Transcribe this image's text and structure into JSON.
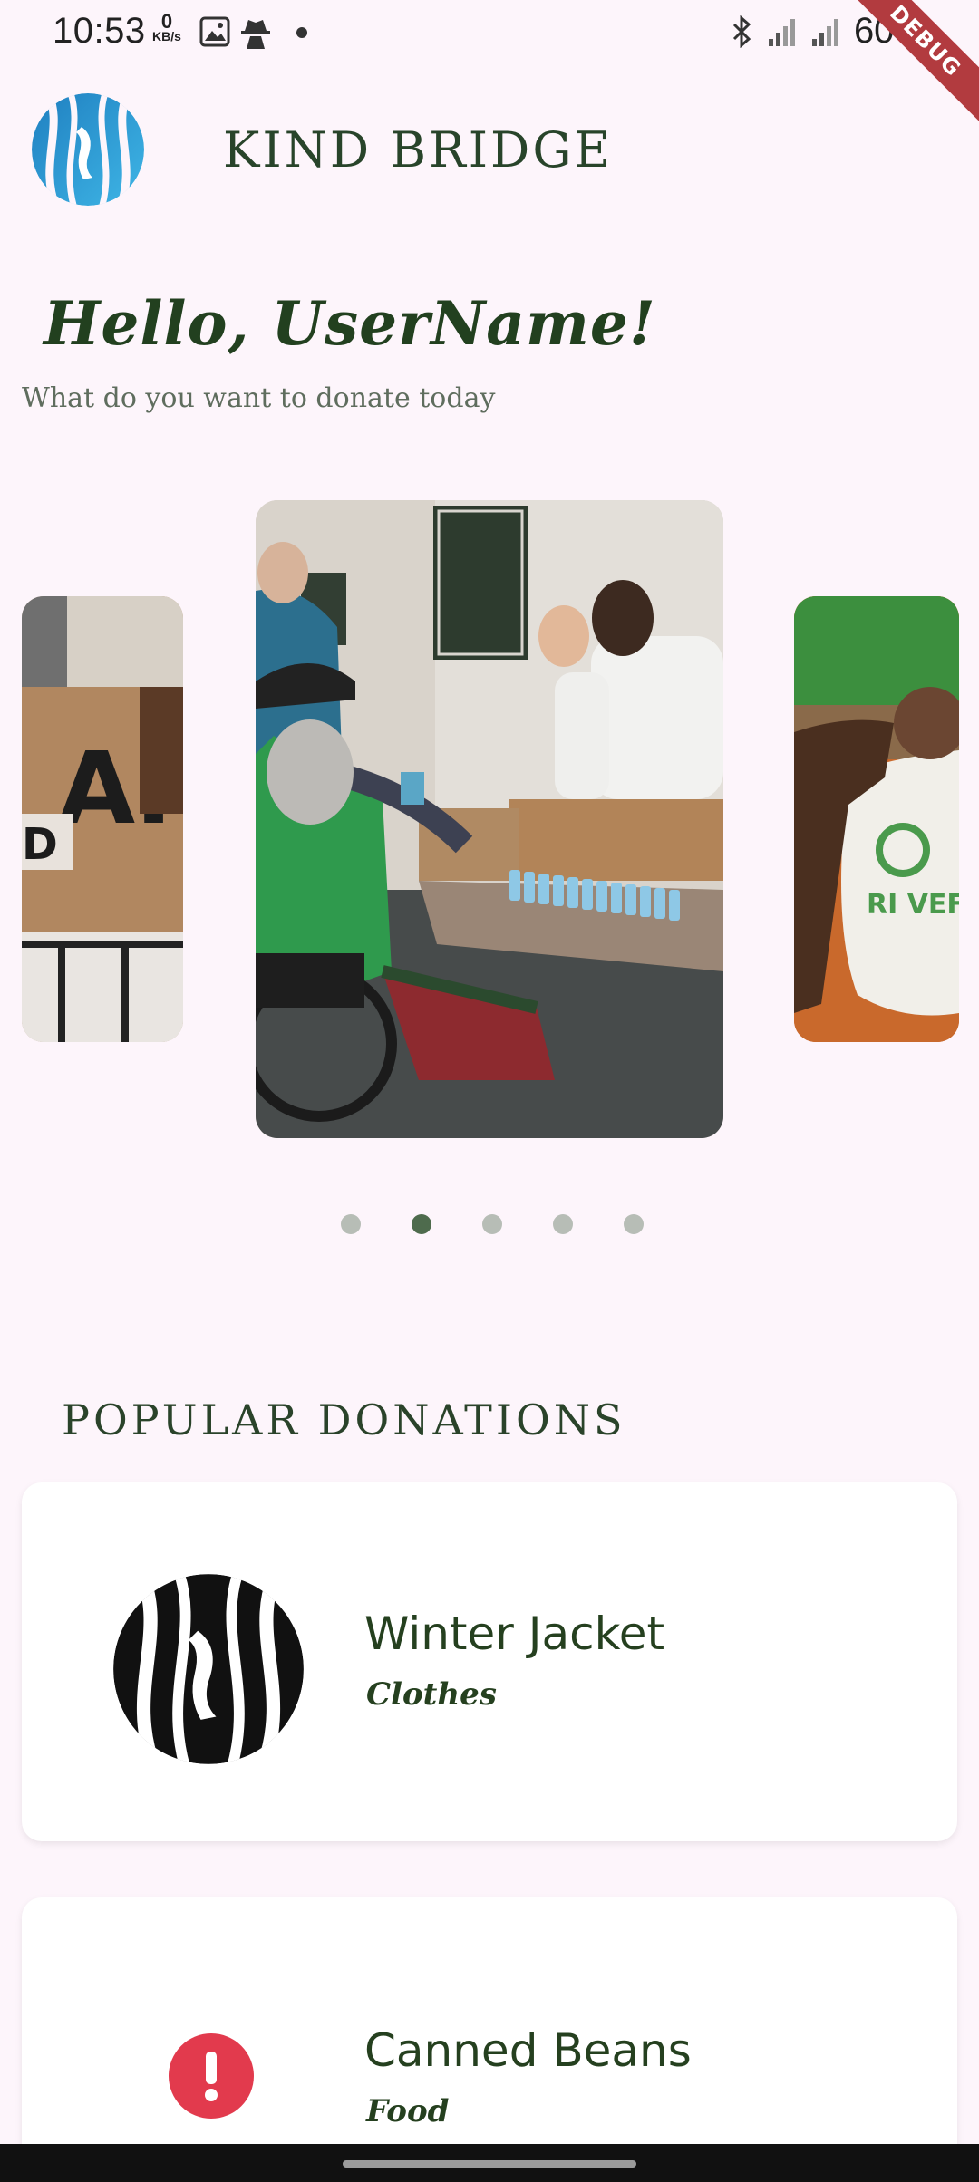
{
  "status_bar": {
    "time": "10:53",
    "net_speed_value": "0",
    "net_speed_unit": "KB/s",
    "battery": "60%",
    "debug_label": "DEBUG"
  },
  "header": {
    "title": "KIND BRIDGE"
  },
  "greeting": {
    "title": "Hello, UserName!",
    "subtitle": "What do you want to donate today"
  },
  "carousel": {
    "slide_count": 5,
    "active_index": 1
  },
  "section": {
    "title": "POPULAR DONATIONS"
  },
  "donations": [
    {
      "name": "Winter Jacket",
      "category": "Clothes",
      "icon": "kind-bridge-logo-icon"
    },
    {
      "name": "Canned Beans",
      "category": "Food",
      "icon": "error-icon"
    }
  ],
  "colors": {
    "accent": "#4e6b4d",
    "background": "#fdf5fb",
    "error": "#e23a4d"
  }
}
